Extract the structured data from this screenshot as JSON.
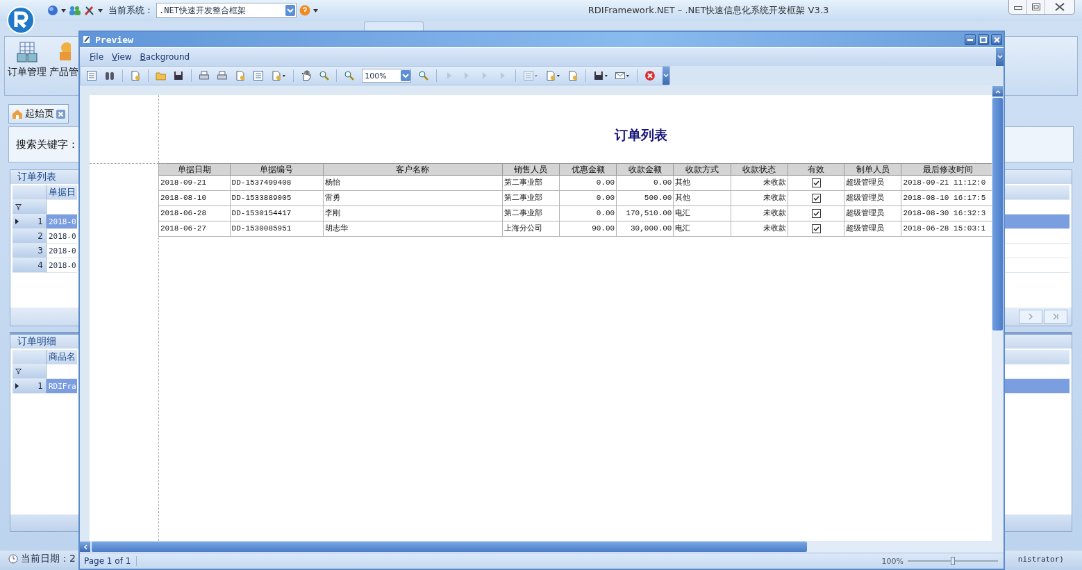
{
  "app": {
    "title": "RDIFramework.NET – .NET快速信息化系统开发框架 V3.3",
    "system_label": "当前系统：",
    "system": ".NET快速开发整合框架"
  },
  "ribbon_buttons": [
    "订单管理",
    "产品管"
  ],
  "doc_tab": "起始页",
  "search_label": "搜索关键字：",
  "order_grid": {
    "title": "订单列表",
    "column": "单据日",
    "rows": [
      {
        "num": "1",
        "value": "2018-0",
        "selected": true
      },
      {
        "num": "2",
        "value": "2018-0",
        "selected": false
      },
      {
        "num": "3",
        "value": "2018-0",
        "selected": false
      },
      {
        "num": "4",
        "value": "2018-0",
        "selected": false
      }
    ]
  },
  "detail_grid": {
    "title": "订单明细",
    "column": "商品名",
    "rows": [
      {
        "num": "1",
        "value": "RDIFra",
        "selected": true
      }
    ]
  },
  "status_bar": {
    "date": "当前日期：2",
    "user": "nistrator)"
  },
  "preview": {
    "title": "Preview",
    "menu": [
      "File",
      "View",
      "Background"
    ],
    "zoom": "100%",
    "report": {
      "title": "订单列表",
      "columns": [
        {
          "label": "单据日期",
          "kind": "text"
        },
        {
          "label": "单据编号",
          "kind": "text"
        },
        {
          "label": "客户名称",
          "kind": "text"
        },
        {
          "label": "销售人员",
          "kind": "text"
        },
        {
          "label": "优惠金额",
          "kind": "amount"
        },
        {
          "label": "收款金额",
          "kind": "amount"
        },
        {
          "label": "收款方式",
          "kind": "text"
        },
        {
          "label": "收款状态",
          "kind": "amount"
        },
        {
          "label": "有效",
          "kind": "check"
        },
        {
          "label": "制单人员",
          "kind": "text"
        },
        {
          "label": "最后修改时间",
          "kind": "text"
        }
      ],
      "rows": [
        {
          "cells": [
            "2018-09-21",
            "DD-1537499408",
            "杨怡",
            "第二事业部",
            "0.00",
            "0.00",
            "其他",
            "未收款",
            true,
            "超级管理员",
            "2018-09-21 11:12:0"
          ]
        },
        {
          "cells": [
            "2018-08-10",
            "DD-1533889005",
            "雷勇",
            "第二事业部",
            "0.00",
            "500.00",
            "其他",
            "未收款",
            true,
            "超级管理员",
            "2018-08-10 16:17:5"
          ]
        },
        {
          "cells": [
            "2018-06-28",
            "DD-1530154417",
            "李刚",
            "第二事业部",
            "0.00",
            "170,510.00",
            "电汇",
            "未收款",
            true,
            "超级管理员",
            "2018-08-30 16:32:3"
          ]
        },
        {
          "cells": [
            "2018-06-27",
            "DD-1530085951",
            "胡志华",
            "上海分公司",
            "90.00",
            "30,000.00",
            "电汇",
            "未收款",
            true,
            "超级管理员",
            "2018-06-28 15:03:1"
          ]
        }
      ]
    },
    "page_status": "Page 1 of 1",
    "status_zoom": "100%",
    "zoom_slider": {
      "level": 0.5
    }
  }
}
